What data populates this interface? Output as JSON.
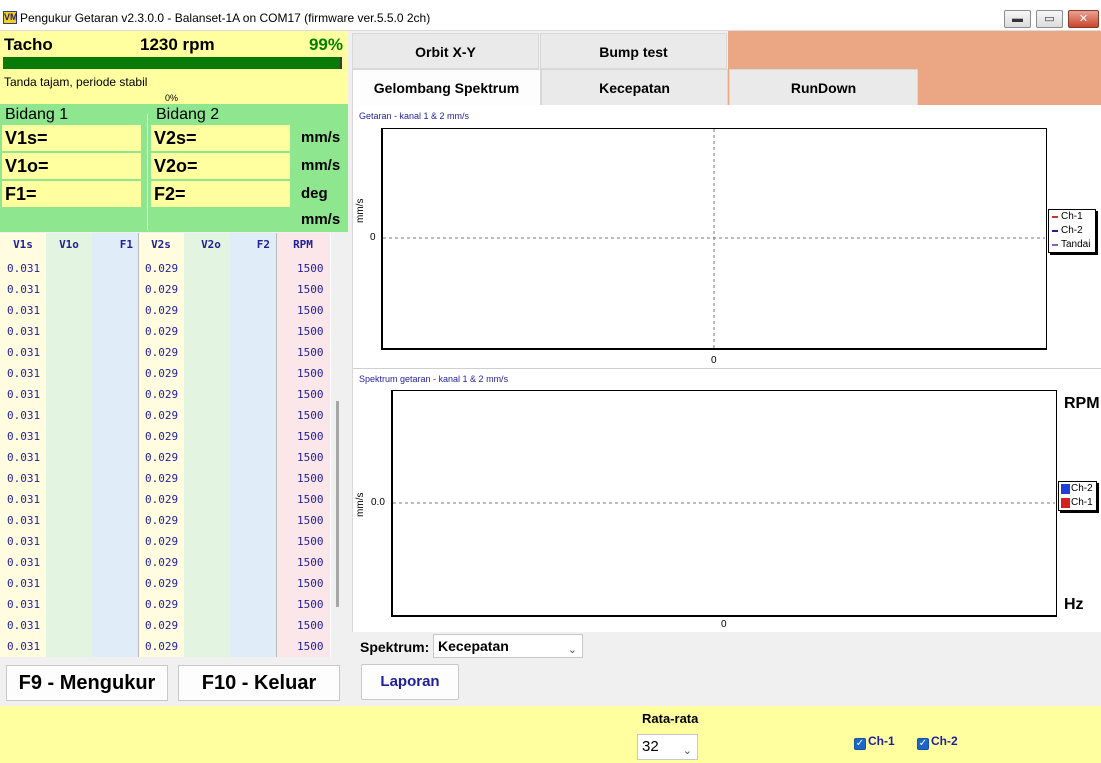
{
  "window": {
    "title": "Pengukur Getaran v2.3.0.0 - Balanset-1A on COM17 (firmware ver.5.5.0 2ch)",
    "icon_text": "VM",
    "controls": {
      "minimize": "▬",
      "maximize": "▭",
      "close": "✕"
    }
  },
  "tacho": {
    "label": "Tacho",
    "rpm": "1230 rpm",
    "percent": "99%",
    "progress": 1.0,
    "status": "Tanda tajam, periode stabil",
    "status_percent": "0%"
  },
  "planes": {
    "plane1_title": "Bidang 1",
    "plane2_title": "Bidang 2",
    "v1s": "V1s=",
    "v1o": "V1o=",
    "f1": "F1=",
    "v2s": "V2s=",
    "v2o": "V2o=",
    "f2": "F2=",
    "units": [
      "mm/s",
      "mm/s",
      "deg",
      "mm/s"
    ]
  },
  "table": {
    "headers": [
      "V1s",
      "V1o",
      "F1",
      "V2s",
      "V2o",
      "F2",
      "RPM"
    ],
    "rows": [
      [
        "0.031",
        "0.029",
        "1500"
      ],
      [
        "0.031",
        "0.029",
        "1500"
      ],
      [
        "0.031",
        "0.029",
        "1500"
      ],
      [
        "0.031",
        "0.029",
        "1500"
      ],
      [
        "0.031",
        "0.029",
        "1500"
      ],
      [
        "0.031",
        "0.029",
        "1500"
      ],
      [
        "0.031",
        "0.029",
        "1500"
      ],
      [
        "0.031",
        "0.029",
        "1500"
      ],
      [
        "0.031",
        "0.029",
        "1500"
      ],
      [
        "0.031",
        "0.029",
        "1500"
      ],
      [
        "0.031",
        "0.029",
        "1500"
      ],
      [
        "0.031",
        "0.029",
        "1500"
      ],
      [
        "0.031",
        "0.029",
        "1500"
      ],
      [
        "0.031",
        "0.029",
        "1500"
      ],
      [
        "0.031",
        "0.029",
        "1500"
      ],
      [
        "0.031",
        "0.029",
        "1500"
      ],
      [
        "0.031",
        "0.029",
        "1500"
      ],
      [
        "0.031",
        "0.029",
        "1500"
      ],
      [
        "0.031",
        "0.029",
        "1500"
      ]
    ]
  },
  "buttons": {
    "f9": "F9 - Mengukur",
    "f10": "F10 - Keluar",
    "laporan": "Laporan"
  },
  "tabs": {
    "orbit": "Orbit X-Y",
    "bump": "Bump test",
    "wave": "Gelombang   Spektrum",
    "speed": "Kecepatan",
    "rundown": "RunDown"
  },
  "chart_data": [
    {
      "type": "line",
      "title": "Getaran  - kanal 1 & 2 mm/s",
      "ylabel": "mm/s",
      "y_tick": "0",
      "x_tick": "0",
      "legend": [
        "Ch-1",
        "Ch-2",
        "Tandai"
      ],
      "legend_colors": [
        "#c0392b",
        "#1f1f9a",
        "#9b59b6"
      ],
      "series": []
    },
    {
      "type": "bar",
      "title": "Spektrum getaran  - kanal 1 & 2 mm/s",
      "ylabel": "mm/s",
      "y_tick": "0.0",
      "x_tick": "0",
      "right_top_label": "RPM",
      "right_bottom_label": "Hz",
      "legend": [
        "Ch-2",
        "Ch-1"
      ],
      "legend_colors": [
        "#1f3fd8",
        "#d62020"
      ],
      "series": []
    }
  ],
  "spectrum": {
    "label": "Spektrum:",
    "selected": "Kecepatan"
  },
  "averaging": {
    "label": "Rata-rata",
    "selected": "32"
  },
  "channels": {
    "ch1": "Ch-1",
    "ch2": "Ch-2",
    "ch1_checked": true,
    "ch2_checked": true
  },
  "colors": {
    "yellow_panel": "#ffffa0",
    "green_panel": "#8ee68e",
    "accent_blue": "#1f1f9a",
    "orange": "#eba683"
  }
}
